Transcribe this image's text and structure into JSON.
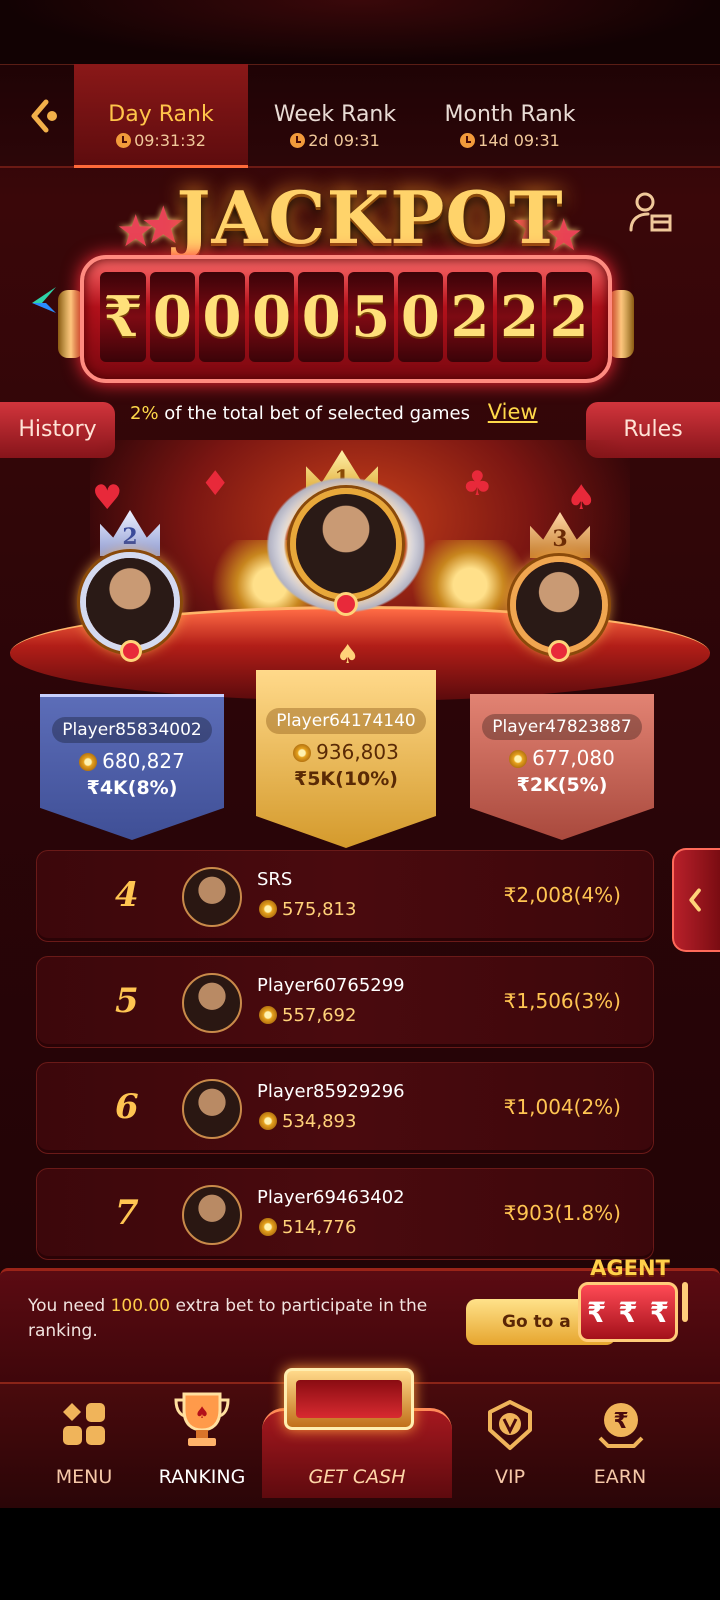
{
  "tabs": [
    {
      "label": "Day Rank",
      "timer": "09:31:32",
      "active": true
    },
    {
      "label": "Week Rank",
      "timer": "2d 09:31",
      "active": false
    },
    {
      "label": "Month Rank",
      "timer": "14d 09:31",
      "active": false
    }
  ],
  "jackpot": {
    "title": "JACKPOT",
    "digits": [
      "₹",
      "0",
      "0",
      "0",
      "0",
      "5",
      "0",
      "2",
      "2",
      "2"
    ]
  },
  "info": {
    "percent": "2%",
    "text": "of the total bet of selected games",
    "view_label": "View",
    "history_label": "History",
    "rules_label": "Rules"
  },
  "podium": [
    {
      "rank": "2",
      "name": "Player85834002",
      "coins": "680,827",
      "prize": "₹4K(8%)"
    },
    {
      "rank": "1",
      "name": "Player64174140",
      "coins": "936,803",
      "prize": "₹5K(10%)"
    },
    {
      "rank": "3",
      "name": "Player47823887",
      "coins": "677,080",
      "prize": "₹2K(5%)"
    }
  ],
  "list": [
    {
      "rank": "4",
      "name": "SRS",
      "coins": "575,813",
      "prize": "₹2,008(4%)"
    },
    {
      "rank": "5",
      "name": "Player60765299",
      "coins": "557,692",
      "prize": "₹1,506(3%)"
    },
    {
      "rank": "6",
      "name": "Player85929296",
      "coins": "534,893",
      "prize": "₹1,004(2%)"
    },
    {
      "rank": "7",
      "name": "Player69463402",
      "coins": "514,776",
      "prize": "₹903(1.8%)"
    }
  ],
  "participate": {
    "prefix": "You need",
    "amount": "100.00",
    "suffix": "extra bet to participate in the ranking.",
    "button_label": "Go to a"
  },
  "agent": {
    "label": "AGENT",
    "symbol": "₹"
  },
  "nav": {
    "menu": "MENU",
    "ranking": "RANKING",
    "get_cash": "GET CASH",
    "vip": "VIP",
    "earn": "EARN"
  },
  "colors": {
    "accent_gold": "#ffc552",
    "tab_active": "#8a1818",
    "panel_red": "#5b0b12"
  }
}
